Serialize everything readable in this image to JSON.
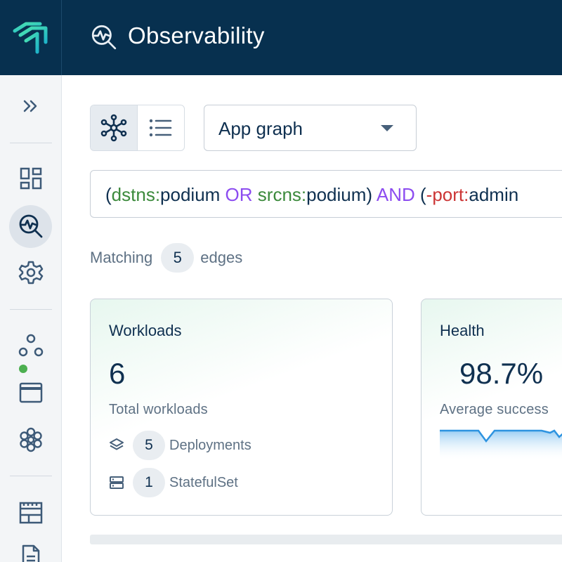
{
  "header": {
    "title": "Observability"
  },
  "view_toggle": {
    "graph_icon": "graph-icon",
    "list_icon": "list-icon",
    "active": "graph"
  },
  "view_select": {
    "value": "App graph"
  },
  "query": {
    "p1": "(",
    "k1": "dstns:",
    "v1": "podium",
    "op1": " OR ",
    "k2": "srcns:",
    "v2": "podium",
    "p2": ")",
    "op2": " AND ",
    "p3": "(",
    "k3": "-port:",
    "v3": "admin"
  },
  "matching": {
    "prefix": "Matching",
    "count": "5",
    "suffix": "edges"
  },
  "workloads": {
    "title": "Workloads",
    "value": "6",
    "subtitle": "Total workloads",
    "deployments_count": "5",
    "deployments_label": "Deployments",
    "statefulset_count": "1",
    "statefulset_label": "StatefulSet"
  },
  "health": {
    "title": "Health",
    "value": "98.7%",
    "subtitle": "Average success",
    "status_color": "#4caf50"
  },
  "colors": {
    "header_bg": "#07304f",
    "accent": "#2fd8a8",
    "keyword": "#3c8a3c",
    "operator": "#8c4cf0",
    "negation": "#cc3535"
  }
}
